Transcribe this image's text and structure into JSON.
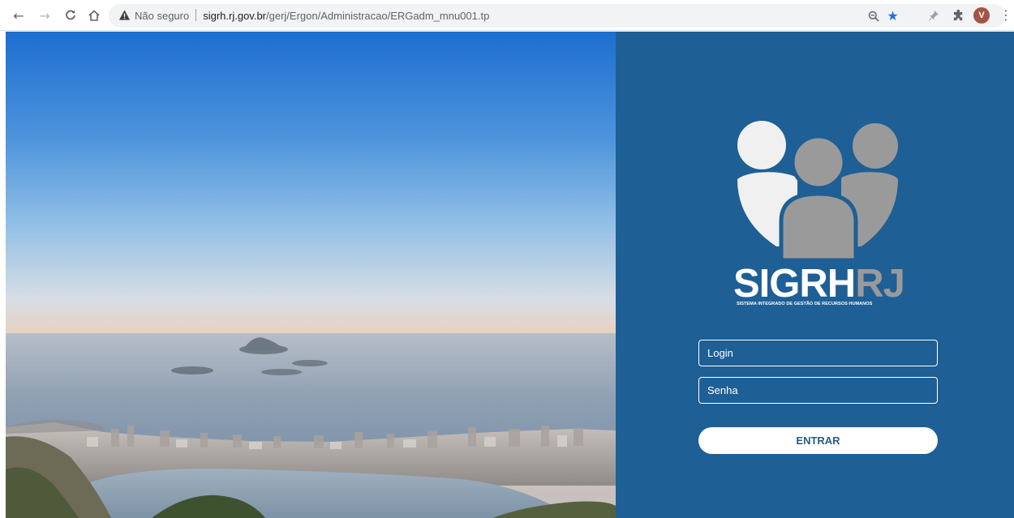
{
  "browser": {
    "back_icon": "arrow-left-icon",
    "forward_icon": "arrow-right-icon",
    "reload_icon": "reload-icon",
    "home_icon": "home-icon",
    "security_label": "Não seguro",
    "url_host": "sigrh.rj.gov.br",
    "url_path": "/gerj/Ergon/Administracao/ERGadm_mnu001.tp",
    "profile_initial": "V",
    "profile_color": "#a45344",
    "bookmark_star_color": "#1a73e8"
  },
  "brand": {
    "name_part1": "SIGRH",
    "name_part2": "RJ",
    "subtitle": "SISTEMA INTEGRADO DE GESTÃO DE RECURSOS HUMANOS",
    "panel_color": "#1e5f95",
    "logo_gray": "#9a9a9a",
    "logo_light": "#f0f0f0"
  },
  "form": {
    "login_placeholder": "Login",
    "senha_placeholder": "Senha",
    "submit_label": "ENTRAR"
  }
}
